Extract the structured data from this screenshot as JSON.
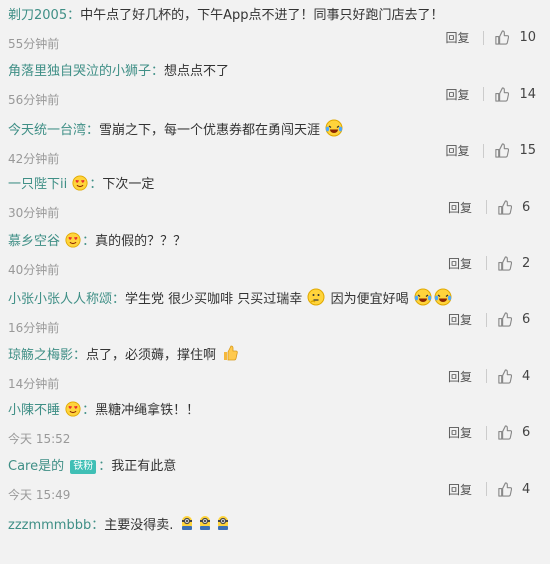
{
  "comments": [
    {
      "author": "剃刀2005",
      "text": "中午点了好几杯的，下午App点不进了！同事只好跑门店去了！",
      "time": "55分钟前",
      "reply": "回复",
      "likes": "10"
    },
    {
      "author": "角落里独自哭泣的小狮子",
      "text": "想点点不了",
      "time": "56分钟前",
      "reply": "回复",
      "likes": "14"
    },
    {
      "author": "今天统一台湾",
      "text": "雪崩之下，每一个优惠券都在勇闯天涯",
      "time": "42分钟前",
      "reply": "回复",
      "likes": "15"
    },
    {
      "author": "一只陛下ii",
      "text": "下次一定",
      "time": "30分钟前",
      "reply": "回复",
      "likes": "6"
    },
    {
      "author": "慕乡空谷",
      "text": "真的假的？？？",
      "time": "40分钟前",
      "reply": "回复",
      "likes": "2"
    },
    {
      "author": "小张小张人人称颂",
      "text": "学生党 很少买咖啡 只买过瑞幸",
      "text2": "因为便宜好喝",
      "time": "16分钟前",
      "reply": "回复",
      "likes": "6"
    },
    {
      "author": "琼觞之梅影",
      "text": "点了，必须薅，撑住啊",
      "time": "14分钟前",
      "reply": "回复",
      "likes": "4"
    },
    {
      "author": "小陳不睡",
      "text": "黑糖冲绳拿铁！！",
      "time": "今天 15:52",
      "reply": "回复",
      "likes": "6"
    },
    {
      "author": "Care是的",
      "badge": "铁粉",
      "text": "我正有此意",
      "time": "今天 15:49",
      "reply": "回复",
      "likes": "4"
    },
    {
      "author": "zzzmmmbbb",
      "text": "主要没得卖."
    }
  ],
  "colors": {
    "author": "#3f8f86",
    "background": "#f2f2f2",
    "badge": "#3fbfb5"
  },
  "icons": [
    "thumbs-up-icon",
    "laughing-crying-emoji",
    "heart-eyes-emoji",
    "thinking-emoji",
    "thumbs-up-emoji",
    "minion-emoji"
  ]
}
